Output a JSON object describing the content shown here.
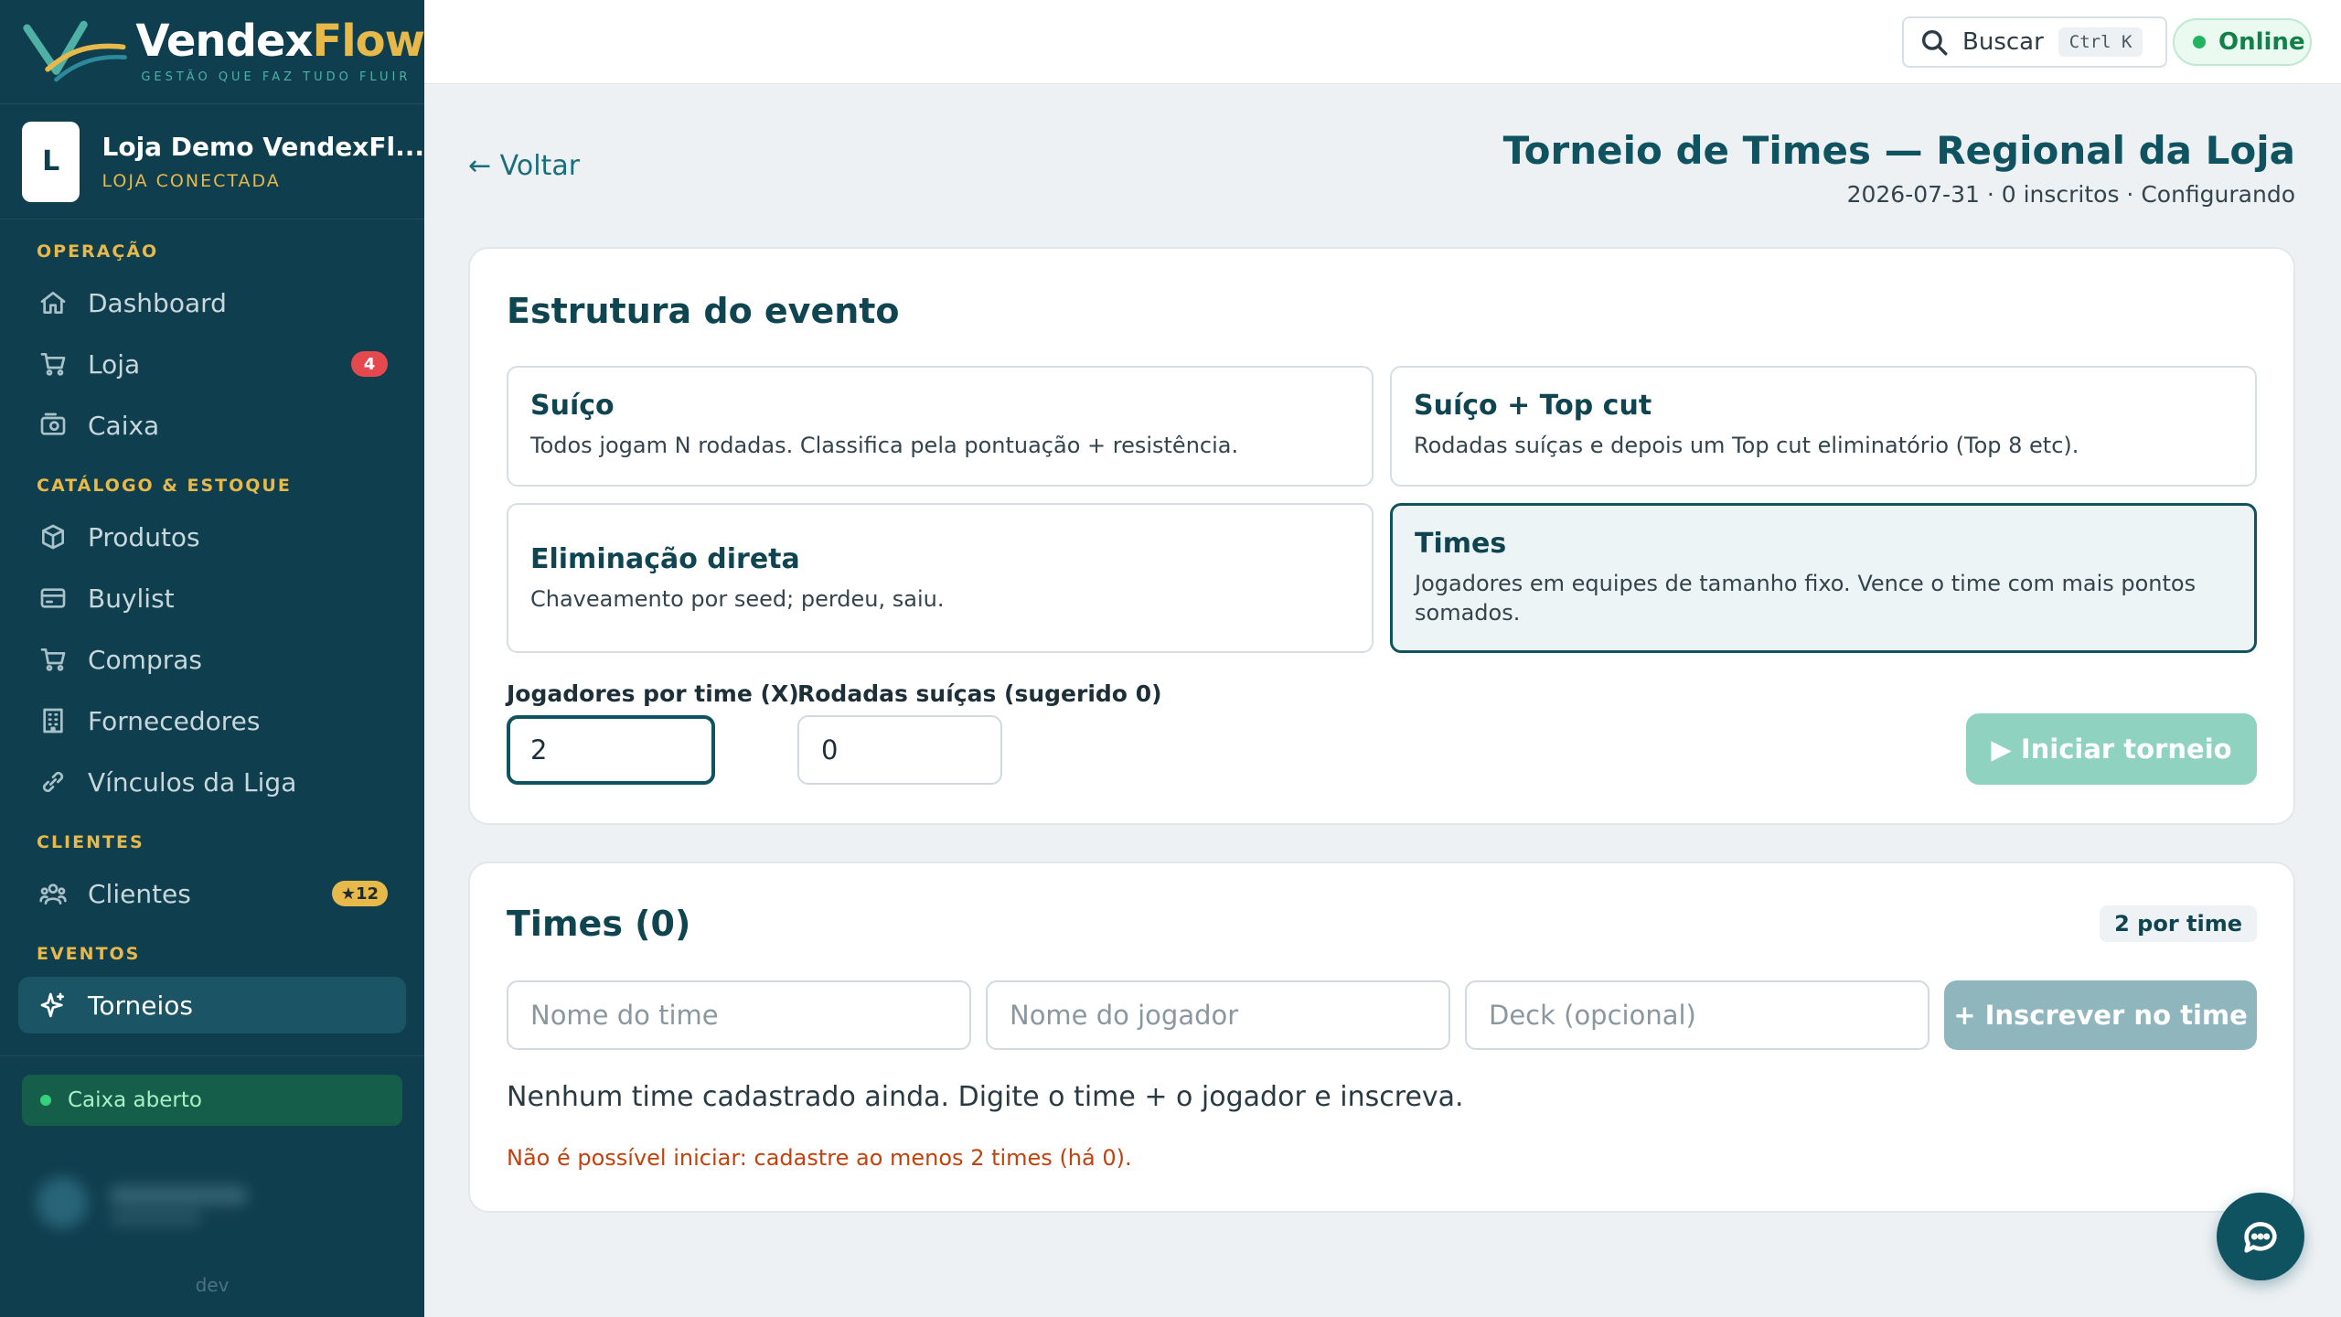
{
  "brand": {
    "name_part1": "Vendex",
    "name_part2": "Flow",
    "tagline": "GESTÃO QUE FAZ TUDO FLUIR"
  },
  "store": {
    "avatar_letter": "L",
    "name": "Loja Demo VendexFl...",
    "status": "LOJA CONECTADA"
  },
  "sidebar": {
    "sections": [
      {
        "label": "OPERAÇÃO"
      },
      {
        "label": "CATÁLOGO & ESTOQUE"
      },
      {
        "label": "CLIENTES"
      },
      {
        "label": "EVENTOS"
      }
    ],
    "items": [
      {
        "label": "Dashboard",
        "icon": "home-icon"
      },
      {
        "label": "Loja",
        "icon": "cart-icon",
        "badge": "4"
      },
      {
        "label": "Caixa",
        "icon": "cash-register-icon"
      },
      {
        "label": "Produtos",
        "icon": "box-icon"
      },
      {
        "label": "Buylist",
        "icon": "card-icon"
      },
      {
        "label": "Compras",
        "icon": "cart-icon"
      },
      {
        "label": "Fornecedores",
        "icon": "building-icon"
      },
      {
        "label": "Vínculos da Liga",
        "icon": "link-icon"
      },
      {
        "label": "Clientes",
        "icon": "users-icon",
        "badge": "★12"
      },
      {
        "label": "Torneios",
        "icon": "sparkle-icon",
        "active": true
      }
    ],
    "caixa_status": "Caixa aberto",
    "env_label": "dev"
  },
  "topbar": {
    "search_label": "Buscar",
    "shortcut": "Ctrl K",
    "status": "Online"
  },
  "header": {
    "back_label": "← Voltar",
    "title": "Torneio de Times — Regional da Loja",
    "meta": "2026-07-31 · 0 inscritos · Configurando"
  },
  "structure": {
    "title": "Estrutura do evento",
    "options": [
      {
        "title": "Suíço",
        "desc": "Todos jogam N rodadas. Classifica pela pontuação + resistência."
      },
      {
        "title": "Suíço + Top cut",
        "desc": "Rodadas suíças e depois um Top cut eliminatório (Top 8 etc)."
      },
      {
        "title": "Eliminação direta",
        "desc": "Chaveamento por seed; perdeu, saiu."
      },
      {
        "title": "Times",
        "desc": "Jogadores em equipes de tamanho fixo. Vence o time com mais pontos somados.",
        "selected": true
      }
    ],
    "players_per_team_label": "Jogadores por time (X)",
    "players_per_team_value": "2",
    "swiss_rounds_label": "Rodadas suíças (sugerido 0)",
    "swiss_rounds_value": "0",
    "start_button": "▶ Iniciar torneio"
  },
  "teams": {
    "title": "Times (0)",
    "per_team_badge": "2 por time",
    "team_name_placeholder": "Nome do time",
    "player_name_placeholder": "Nome do jogador",
    "deck_placeholder": "Deck (opcional)",
    "enroll_button": "+ Inscrever no time",
    "empty_message": "Nenhum time cadastrado ainda. Digite o time + o jogador e inscreva.",
    "warning": "Não é possível iniciar: cadastre ao menos 2 times (há 0)."
  },
  "colors": {
    "sidebar_bg": "#0f3e4e",
    "accent_gold": "#e7b84a",
    "primary_teal": "#0f5360",
    "warning": "#c2410c",
    "online": "#22b45e"
  }
}
